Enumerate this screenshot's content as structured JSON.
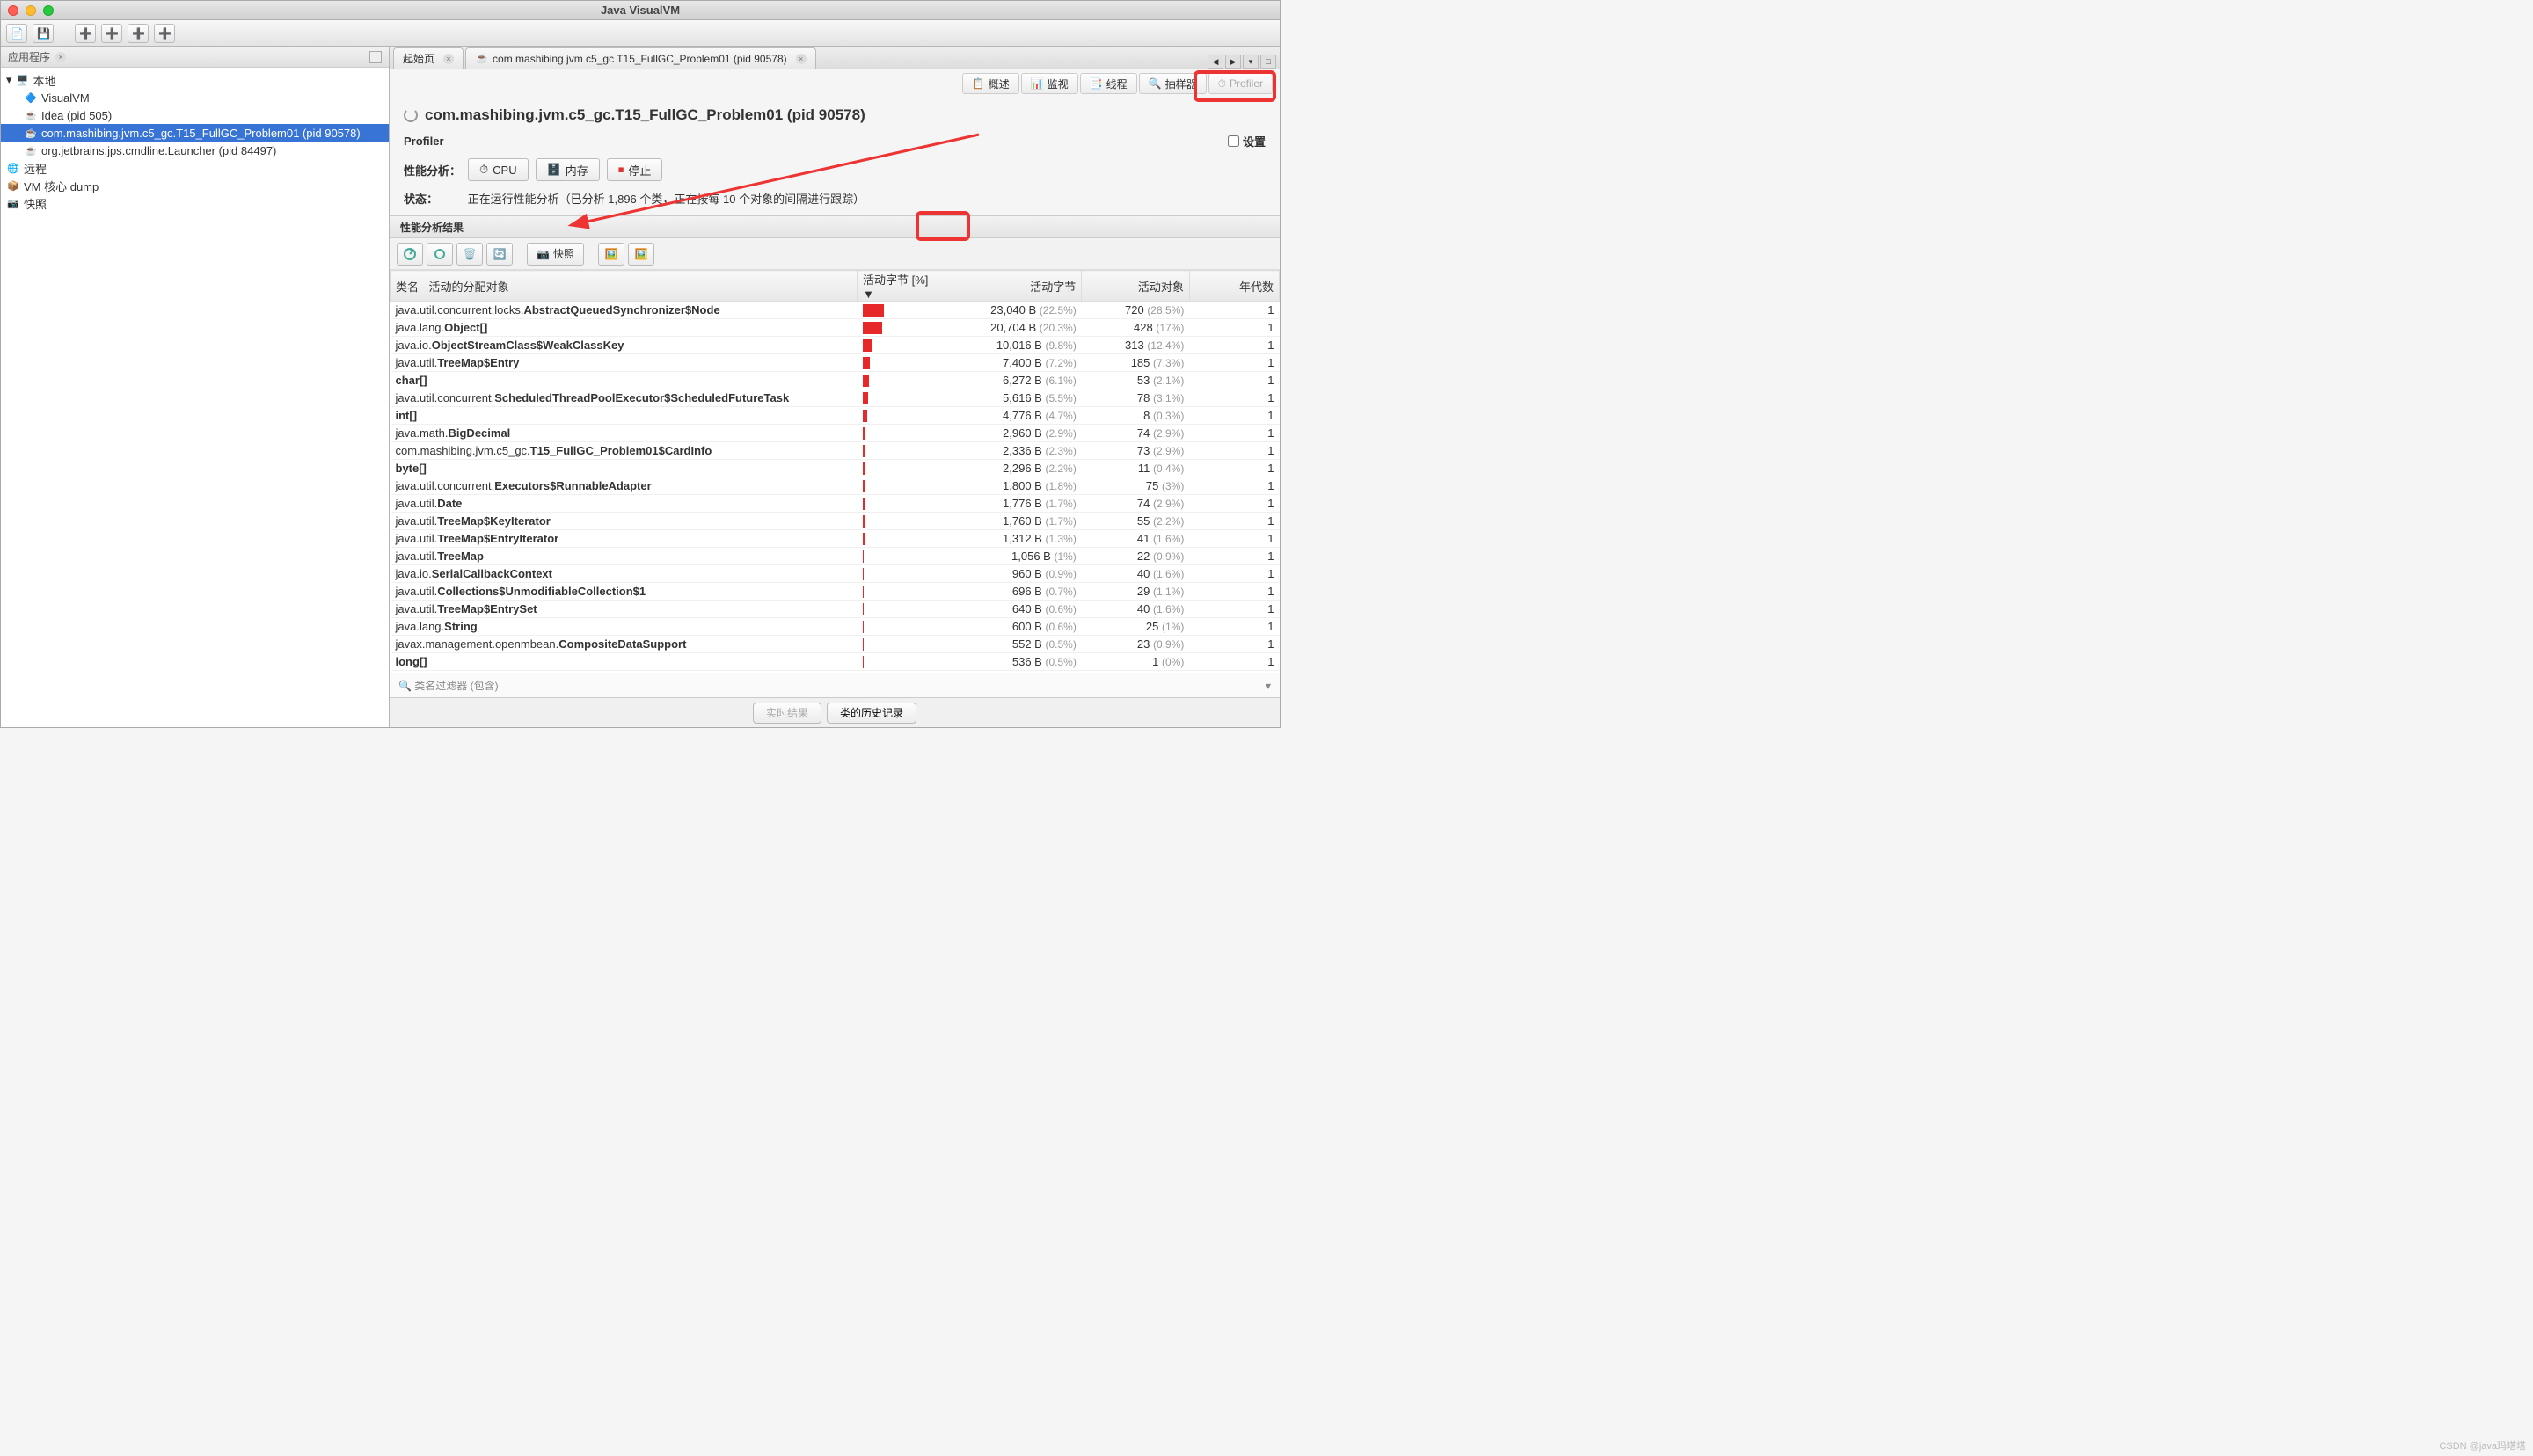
{
  "window": {
    "title": "Java VisualVM"
  },
  "sidebar": {
    "header": "应用程序",
    "nodes": {
      "local": "本地",
      "items": [
        {
          "label": "VisualVM"
        },
        {
          "label": "Idea (pid 505)"
        },
        {
          "label": "com.mashibing.jvm.c5_gc.T15_FullGC_Problem01 (pid 90578)",
          "selected": true
        },
        {
          "label": "org.jetbrains.jps.cmdline.Launcher (pid 84497)"
        }
      ],
      "remote": "远程",
      "vmcore": "VM 核心 dump",
      "snapshot": "快照"
    }
  },
  "tabs": {
    "start": "起始页",
    "main": "com mashibing jvm c5_gc T15_FullGC_Problem01 (pid 90578)"
  },
  "subtabs": {
    "overview": "概述",
    "monitor": "监视",
    "threads": "线程",
    "sampler": "抽样器",
    "profiler": "Profiler"
  },
  "page": {
    "title": "com.mashibing.jvm.c5_gc.T15_FullGC_Problem01 (pid 90578)",
    "section": "Profiler",
    "settings": "设置"
  },
  "perf": {
    "label": "性能分析：",
    "cpu": "CPU",
    "mem": "内存",
    "stop": "停止",
    "status_label": "状态：",
    "status_text": "正在运行性能分析（已分析 1,896 个类，正在按每 10 个对象的间隔进行跟踪）"
  },
  "results": {
    "header": "性能分析结果",
    "snapshot_btn": "快照",
    "columns": {
      "class": "类名 - 活动的分配对象",
      "bytes_pct": "活动字节  [%]",
      "bytes": "活动字节",
      "objects": "活动对象",
      "gens": "年代数"
    },
    "rows": [
      {
        "plain": "java.util.concurrent.locks.",
        "bold": "AbstractQueuedSynchronizer$Node",
        "barw": 24,
        "bytes": "23,040 B",
        "bpct": "(22.5%)",
        "objs": "720",
        "opct": "(28.5%)",
        "gen": "1"
      },
      {
        "plain": "java.lang.",
        "bold": "Object[]",
        "barw": 22,
        "bytes": "20,704 B",
        "bpct": "(20.3%)",
        "objs": "428",
        "opct": "(17%)",
        "gen": "1"
      },
      {
        "plain": "java.io.",
        "bold": "ObjectStreamClass$WeakClassKey",
        "barw": 11,
        "bytes": "10,016 B",
        "bpct": "(9.8%)",
        "objs": "313",
        "opct": "(12.4%)",
        "gen": "1"
      },
      {
        "plain": "java.util.",
        "bold": "TreeMap$Entry",
        "barw": 8,
        "bytes": "7,400 B",
        "bpct": "(7.2%)",
        "objs": "185",
        "opct": "(7.3%)",
        "gen": "1"
      },
      {
        "plain": "",
        "bold": "char[]",
        "barw": 7,
        "bytes": "6,272 B",
        "bpct": "(6.1%)",
        "objs": "53",
        "opct": "(2.1%)",
        "gen": "1"
      },
      {
        "plain": "java.util.concurrent.",
        "bold": "ScheduledThreadPoolExecutor$ScheduledFutureTask",
        "barw": 6,
        "bytes": "5,616 B",
        "bpct": "(5.5%)",
        "objs": "78",
        "opct": "(3.1%)",
        "gen": "1"
      },
      {
        "plain": "",
        "bold": "int[]",
        "barw": 5,
        "bytes": "4,776 B",
        "bpct": "(4.7%)",
        "objs": "8",
        "opct": "(0.3%)",
        "gen": "1"
      },
      {
        "plain": "java.math.",
        "bold": "BigDecimal",
        "barw": 3,
        "bytes": "2,960 B",
        "bpct": "(2.9%)",
        "objs": "74",
        "opct": "(2.9%)",
        "gen": "1"
      },
      {
        "plain": "com.mashibing.jvm.c5_gc.",
        "bold": "T15_FullGC_Problem01$CardInfo",
        "barw": 3,
        "bytes": "2,336 B",
        "bpct": "(2.3%)",
        "objs": "73",
        "opct": "(2.9%)",
        "gen": "1"
      },
      {
        "plain": "",
        "bold": "byte[]",
        "barw": 2,
        "bytes": "2,296 B",
        "bpct": "(2.2%)",
        "objs": "11",
        "opct": "(0.4%)",
        "gen": "1"
      },
      {
        "plain": "java.util.concurrent.",
        "bold": "Executors$RunnableAdapter",
        "barw": 2,
        "bytes": "1,800 B",
        "bpct": "(1.8%)",
        "objs": "75",
        "opct": "(3%)",
        "gen": "1"
      },
      {
        "plain": "java.util.",
        "bold": "Date",
        "barw": 2,
        "bytes": "1,776 B",
        "bpct": "(1.7%)",
        "objs": "74",
        "opct": "(2.9%)",
        "gen": "1"
      },
      {
        "plain": "java.util.",
        "bold": "TreeMap$KeyIterator",
        "barw": 2,
        "bytes": "1,760 B",
        "bpct": "(1.7%)",
        "objs": "55",
        "opct": "(2.2%)",
        "gen": "1"
      },
      {
        "plain": "java.util.",
        "bold": "TreeMap$EntryIterator",
        "barw": 2,
        "bytes": "1,312 B",
        "bpct": "(1.3%)",
        "objs": "41",
        "opct": "(1.6%)",
        "gen": "1"
      },
      {
        "plain": "java.util.",
        "bold": "TreeMap",
        "barw": 1,
        "bytes": "1,056 B",
        "bpct": "(1%)",
        "objs": "22",
        "opct": "(0.9%)",
        "gen": "1"
      },
      {
        "plain": "java.io.",
        "bold": "SerialCallbackContext",
        "barw": 1,
        "bytes": "960 B",
        "bpct": "(0.9%)",
        "objs": "40",
        "opct": "(1.6%)",
        "gen": "1"
      },
      {
        "plain": "java.util.",
        "bold": "Collections$UnmodifiableCollection$1",
        "barw": 1,
        "bytes": "696 B",
        "bpct": "(0.7%)",
        "objs": "29",
        "opct": "(1.1%)",
        "gen": "1"
      },
      {
        "plain": "java.util.",
        "bold": "TreeMap$EntrySet",
        "barw": 1,
        "bytes": "640 B",
        "bpct": "(0.6%)",
        "objs": "40",
        "opct": "(1.6%)",
        "gen": "1"
      },
      {
        "plain": "java.lang.",
        "bold": "String",
        "barw": 1,
        "bytes": "600 B",
        "bpct": "(0.6%)",
        "objs": "25",
        "opct": "(1%)",
        "gen": "1"
      },
      {
        "plain": "javax.management.openmbean.",
        "bold": "CompositeDataSupport",
        "barw": 1,
        "bytes": "552 B",
        "bpct": "(0.5%)",
        "objs": "23",
        "opct": "(0.9%)",
        "gen": "1"
      },
      {
        "plain": "",
        "bold": "long[]",
        "barw": 1,
        "bytes": "536 B",
        "bpct": "(0.5%)",
        "objs": "1",
        "opct": "(0%)",
        "gen": "1"
      }
    ]
  },
  "filter": {
    "placeholder": "类名过滤器 (包含)"
  },
  "bottom": {
    "live": "实时结果",
    "history": "类的历史记录"
  },
  "watermark": "CSDN @java玛塔塔"
}
